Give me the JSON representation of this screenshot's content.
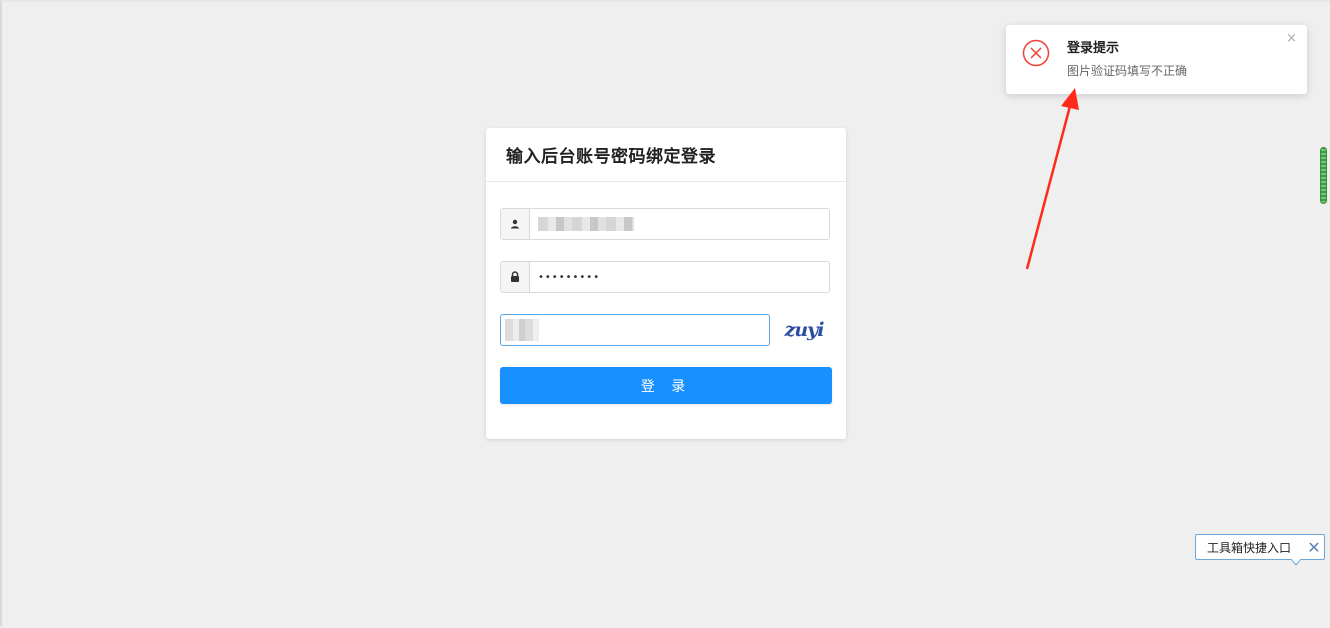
{
  "login": {
    "title": "输入后台账号密码绑定登录",
    "password_mask": "•••••••••",
    "captcha_text": "zuyi",
    "login_label": "登 录"
  },
  "toast": {
    "title": "登录提示",
    "message": "图片验证码填写不正确",
    "close": "×"
  },
  "toolbox": {
    "label": "工具箱快捷入口",
    "close": "✕"
  },
  "colors": {
    "primary": "#1890ff",
    "error": "#f04134",
    "annotation_arrow": "#ff2a1a"
  }
}
